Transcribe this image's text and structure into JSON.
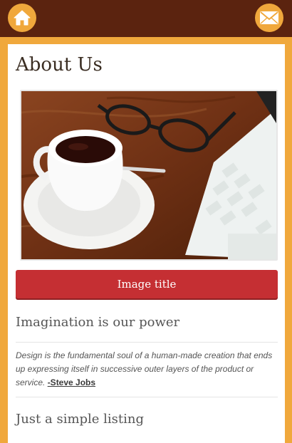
{
  "header": {
    "home_icon": "home-icon",
    "mail_icon": "envelope-icon"
  },
  "page": {
    "title": "About Us"
  },
  "image": {
    "description": "coffee-cup-glasses-laptop-photo",
    "button_label": "Image title"
  },
  "section1": {
    "heading": "Imagination is our power",
    "quote": "Design is the fundamental soul of a human-made creation that ends up expressing itself in successive outer layers of the product or service.",
    "author": "-Steve Jobs"
  },
  "section2": {
    "heading": "Just a simple listing"
  },
  "colors": {
    "accent": "#f0a83c",
    "header": "#5b230f",
    "button": "#c52f33"
  }
}
